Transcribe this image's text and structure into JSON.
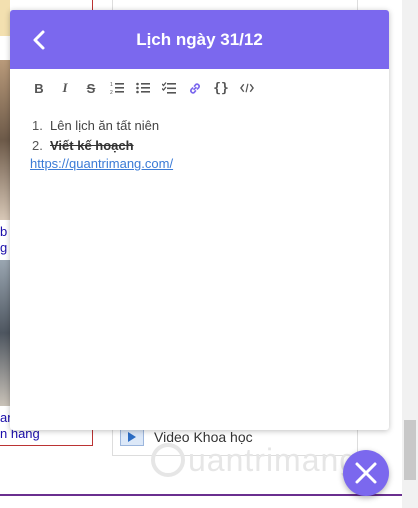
{
  "background": {
    "left_links": [
      "b",
      "g",
      "ar",
      "n hang"
    ],
    "video_label": "Video Khoa học",
    "watermark": "Quantrimang"
  },
  "note": {
    "title": "Lịch ngày 31/12",
    "toolbar": [
      "bold-icon",
      "italic-icon",
      "strikethrough-icon",
      "ordered-list-icon",
      "bullet-list-icon",
      "checklist-icon",
      "link-icon",
      "code-block-icon",
      "code-icon"
    ],
    "items": [
      {
        "num": "1.",
        "text": "Lên lịch ăn tất niên",
        "done": false
      },
      {
        "num": "2.",
        "text": "Viết kế hoạch",
        "done": true
      }
    ],
    "link": "https://quantrimang.com/"
  },
  "colors": {
    "accent": "#7b68ee",
    "link": "#3b7bd6"
  }
}
